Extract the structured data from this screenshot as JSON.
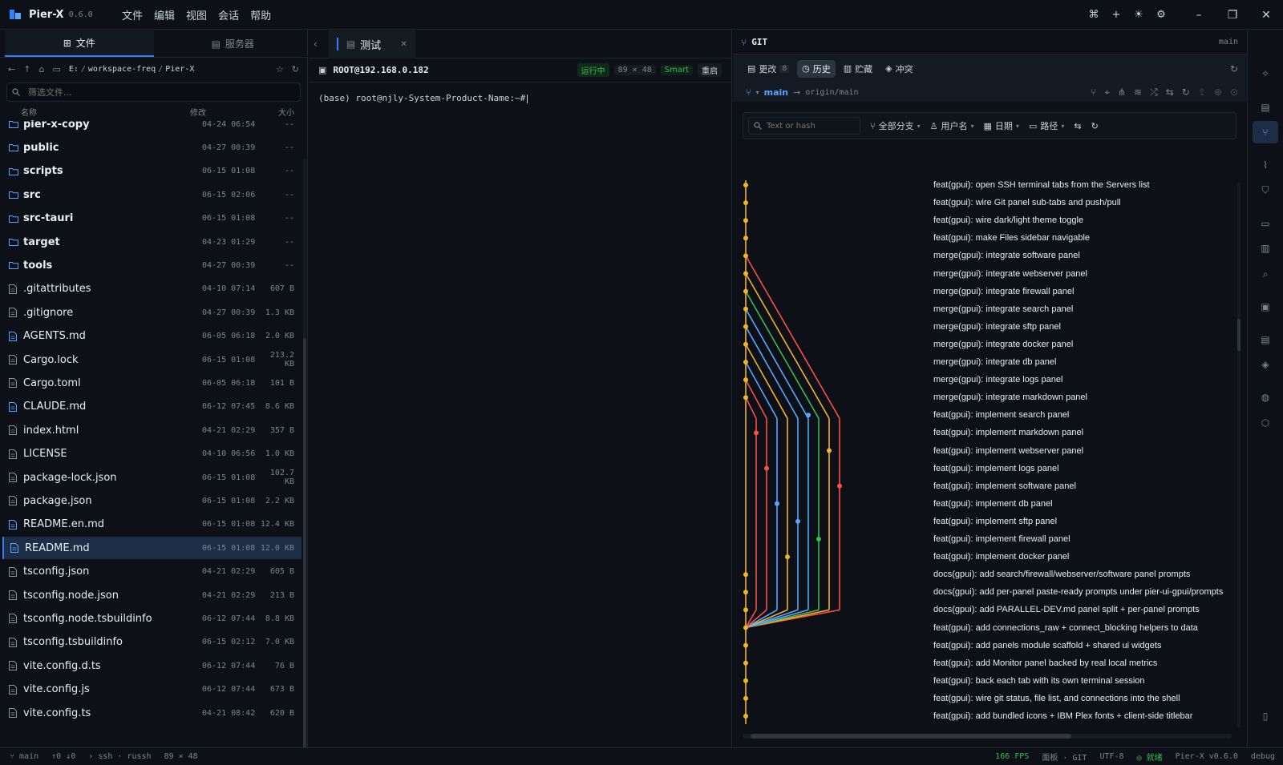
{
  "app": {
    "name": "Pier-X",
    "version": "0.6.0"
  },
  "menu": [
    "文件",
    "编辑",
    "视图",
    "会话",
    "帮助"
  ],
  "left_panel": {
    "tabs": [
      {
        "label": "文件"
      },
      {
        "label": "服务器"
      }
    ],
    "path": {
      "drive": "E:",
      "folders": [
        "workspace-freq",
        "Pier-X"
      ]
    },
    "filter_placeholder": "筛选文件...",
    "columns": {
      "name": "名称",
      "modified": "修改",
      "size": "大小"
    },
    "files": [
      {
        "name": "pier-x-copy",
        "modified": "04-24 06:54",
        "size": "--",
        "type": "dir"
      },
      {
        "name": "public",
        "modified": "04-27 00:39",
        "size": "--",
        "type": "dir"
      },
      {
        "name": "scripts",
        "modified": "06-15 01:08",
        "size": "--",
        "type": "dir"
      },
      {
        "name": "src",
        "modified": "06-15 02:06",
        "size": "--",
        "type": "dir"
      },
      {
        "name": "src-tauri",
        "modified": "06-15 01:08",
        "size": "--",
        "type": "dir"
      },
      {
        "name": "target",
        "modified": "04-23 01:29",
        "size": "--",
        "type": "dir"
      },
      {
        "name": "tools",
        "modified": "04-27 00:39",
        "size": "--",
        "type": "dir"
      },
      {
        "name": ".gitattributes",
        "modified": "04-10 07:14",
        "size": "607 B",
        "type": "file"
      },
      {
        "name": ".gitignore",
        "modified": "04-27 00:39",
        "size": "1.3 KB",
        "type": "file"
      },
      {
        "name": "AGENTS.md",
        "modified": "06-05 06:18",
        "size": "2.0 KB",
        "type": "md"
      },
      {
        "name": "Cargo.lock",
        "modified": "06-15 01:08",
        "size": "213.2 KB",
        "type": "file"
      },
      {
        "name": "Cargo.toml",
        "modified": "06-05 06:18",
        "size": "101 B",
        "type": "file"
      },
      {
        "name": "CLAUDE.md",
        "modified": "06-12 07:45",
        "size": "8.6 KB",
        "type": "md"
      },
      {
        "name": "index.html",
        "modified": "04-21 02:29",
        "size": "357 B",
        "type": "file"
      },
      {
        "name": "LICENSE",
        "modified": "04-10 06:56",
        "size": "1.0 KB",
        "type": "file"
      },
      {
        "name": "package-lock.json",
        "modified": "06-15 01:08",
        "size": "102.7 KB",
        "type": "file"
      },
      {
        "name": "package.json",
        "modified": "06-15 01:08",
        "size": "2.2 KB",
        "type": "file"
      },
      {
        "name": "README.en.md",
        "modified": "06-15 01:08",
        "size": "12.4 KB",
        "type": "md"
      },
      {
        "name": "README.md",
        "modified": "06-15 01:08",
        "size": "12.0 KB",
        "type": "md",
        "selected": true
      },
      {
        "name": "tsconfig.json",
        "modified": "04-21 02:29",
        "size": "605 B",
        "type": "file"
      },
      {
        "name": "tsconfig.node.json",
        "modified": "04-21 02:29",
        "size": "213 B",
        "type": "file"
      },
      {
        "name": "tsconfig.node.tsbuildinfo",
        "modified": "06-12 07:44",
        "size": "8.8 KB",
        "type": "file"
      },
      {
        "name": "tsconfig.tsbuildinfo",
        "modified": "06-15 02:12",
        "size": "7.0 KB",
        "type": "file"
      },
      {
        "name": "vite.config.d.ts",
        "modified": "06-12 07:44",
        "size": "76 B",
        "type": "file"
      },
      {
        "name": "vite.config.js",
        "modified": "06-12 07:44",
        "size": "673 B",
        "type": "file"
      },
      {
        "name": "vite.config.ts",
        "modified": "04-21 08:42",
        "size": "620 B",
        "type": "file"
      }
    ]
  },
  "terminal": {
    "tab_label": "测试",
    "host": "ROOT@192.168.0.182",
    "status": "运行中",
    "size": "89 × 48",
    "mode": "Smart",
    "restart": "重启",
    "prompt": "(base) root@njly-System-Product-Name:~#"
  },
  "git": {
    "title": "GIT",
    "branch_label": "main",
    "tabs": [
      {
        "label": "更改",
        "count": "8"
      },
      {
        "label": "历史"
      },
      {
        "label": "贮藏"
      },
      {
        "label": "冲突"
      }
    ],
    "current_branch": "main",
    "upstream": "origin/main",
    "search_placeholder": "Text or hash",
    "filters": [
      "全部分支",
      "用户名",
      "日期",
      "路径"
    ],
    "lane_colors": [
      "#f0b429",
      "#f85149",
      "#58a6ff",
      "#f0b429",
      "#58a6ff",
      "#58a6ff",
      "#3fb950",
      "#f0b429",
      "#f85149"
    ],
    "commits": [
      "feat(gpui): open SSH terminal tabs from the Servers list",
      "feat(gpui): wire Git panel sub-tabs and push/pull",
      "feat(gpui): wire dark/light theme toggle",
      "feat(gpui): make Files sidebar navigable",
      "merge(gpui): integrate software panel",
      "merge(gpui): integrate webserver panel",
      "merge(gpui): integrate firewall panel",
      "merge(gpui): integrate search panel",
      "merge(gpui): integrate sftp panel",
      "merge(gpui): integrate docker panel",
      "merge(gpui): integrate db panel",
      "merge(gpui): integrate logs panel",
      "merge(gpui): integrate markdown panel",
      "feat(gpui): implement search panel",
      "feat(gpui): implement markdown panel",
      "feat(gpui): implement webserver panel",
      "feat(gpui): implement logs panel",
      "feat(gpui): implement software panel",
      "feat(gpui): implement db panel",
      "feat(gpui): implement sftp panel",
      "feat(gpui): implement firewall panel",
      "feat(gpui): implement docker panel",
      "docs(gpui): add search/firewall/webserver/software panel prompts",
      "docs(gpui): add per-panel paste-ready prompts under pier-ui-gpui/prompts",
      "docs(gpui): add PARALLEL-DEV.md panel split + per-panel prompts",
      "feat(gpui): add connections_raw + connect_blocking helpers to data",
      "feat(gpui): add panels module scaffold + shared ui widgets",
      "feat(gpui): add Monitor panel backed by real local metrics",
      "feat(gpui): back each tab with its own terminal session",
      "feat(gpui): wire git status, file list, and connections into the shell",
      "feat(gpui): add bundled icons + IBM Plex fonts + client-side titlebar"
    ]
  },
  "status": {
    "branch": "main",
    "sync": "↑0 ↓0",
    "session": "ssh · russh",
    "size": "89 × 48",
    "fps": "166 FPS",
    "panel": "面板 · GIT",
    "encoding": "UTF-8",
    "ready": "就绪",
    "version": "Pier-X v0.6.0",
    "mode": "debug"
  }
}
